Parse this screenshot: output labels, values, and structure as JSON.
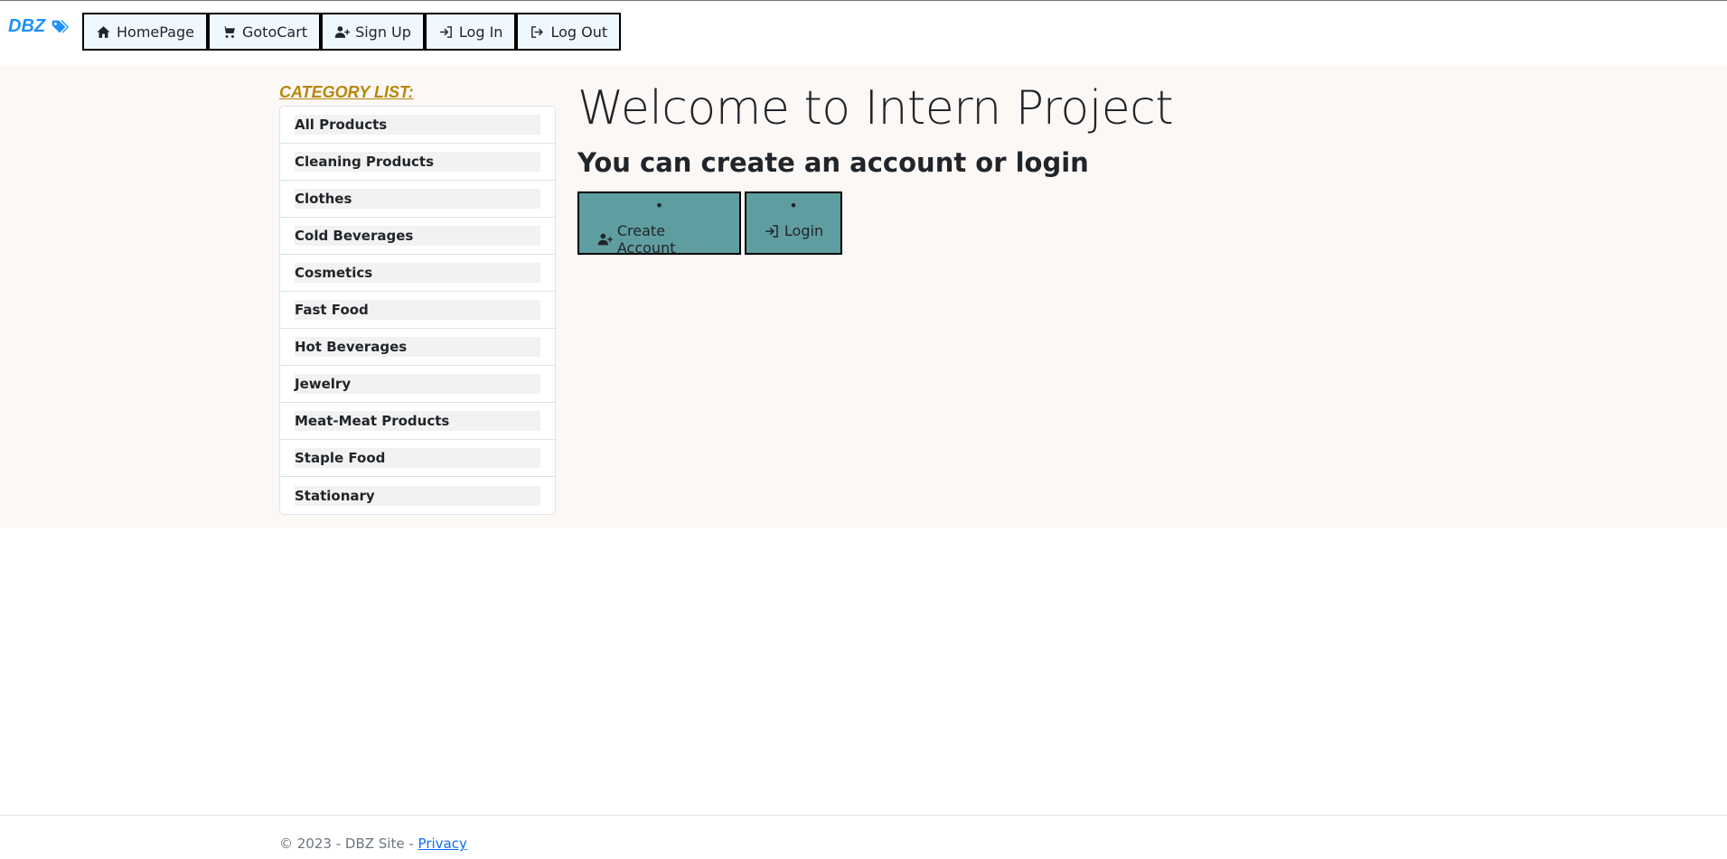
{
  "brand": {
    "name": "DBZ",
    "icon": "tags-icon",
    "color": "#1e90ff"
  },
  "nav": {
    "items": [
      {
        "label": "HomePage",
        "icon": "home-icon"
      },
      {
        "label": "GotoCart",
        "icon": "cart-icon"
      },
      {
        "label": "Sign Up",
        "icon": "user-plus-icon"
      },
      {
        "label": "Log In",
        "icon": "login-icon"
      },
      {
        "label": "Log Out",
        "icon": "logout-icon"
      }
    ]
  },
  "categories": {
    "title": "CATEGORY LIST:",
    "items": [
      "All Products",
      "Cleaning Products",
      "Clothes",
      "Cold Beverages",
      "Cosmetics",
      "Fast Food",
      "Hot Beverages",
      "Jewelry",
      "Meat-Meat Products",
      "Staple Food",
      "Stationary"
    ]
  },
  "main": {
    "welcome": "Welcome to Intern Project",
    "subheading": "You can create an account or login",
    "create_account_label": "Create Account",
    "login_label": "Login",
    "bullet": "•"
  },
  "footer": {
    "text": "© 2023 - DBZ Site - ",
    "privacy_label": "Privacy"
  },
  "colors": {
    "accent_button": "#5f9ea0",
    "category_title": "#b8860b",
    "band_background": "#fcf8f6",
    "nav_button_bg": "#f0f8ff"
  }
}
